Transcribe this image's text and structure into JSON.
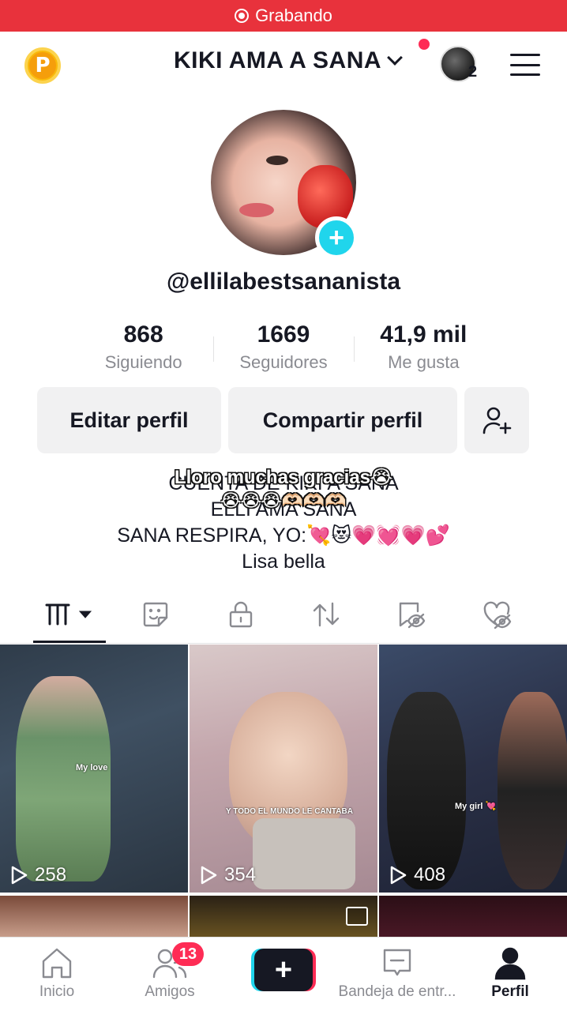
{
  "recording_bar": {
    "label": "Grabando",
    "color": "#e8323c"
  },
  "header": {
    "account_name": "KIKI AMA A SANA",
    "friends_avatar_count": "2"
  },
  "profile": {
    "username": "@ellilabestsananista",
    "stats": [
      {
        "value": "868",
        "label": "Siguiendo"
      },
      {
        "value": "1669",
        "label": "Seguidores"
      },
      {
        "value": "41,9 mil",
        "label": "Me gusta"
      }
    ],
    "buttons": {
      "edit": "Editar perfil",
      "share": "Compartir perfil"
    },
    "bio_lines": [
      "CUENTA DE KIKI A SANA",
      "ELLI AMA SANA",
      "SANA RESPIRA, YO:💘😻💗💓💗💕",
      "Lisa bella"
    ],
    "overlay_text": {
      "line1": "Lloro muchas gracias😭",
      "line2": "😭😭😭🫶🏻🫶🏻🫶🏻"
    }
  },
  "tabs": [
    {
      "name": "videos",
      "icon": "grid-icon"
    },
    {
      "name": "stickers",
      "icon": "sticker-icon"
    },
    {
      "name": "private",
      "icon": "lock-icon"
    },
    {
      "name": "reposts",
      "icon": "repost-icon"
    },
    {
      "name": "favorites",
      "icon": "hidden-bookmark-icon"
    },
    {
      "name": "liked",
      "icon": "hidden-heart-icon"
    }
  ],
  "videos": [
    {
      "views": "258",
      "caption": "My love"
    },
    {
      "views": "354",
      "caption": "Y TODO EL MUNDO LE CANTABA"
    },
    {
      "views": "408",
      "caption": "My girl 💘"
    }
  ],
  "bottom_nav": {
    "home": "Inicio",
    "friends": "Amigos",
    "friends_badge": "13",
    "create": "+",
    "inbox": "Bandeja de entr...",
    "profile": "Perfil"
  },
  "colors": {
    "accent_cyan": "#20d5ec",
    "accent_red": "#fe2c55",
    "text_dark": "#161823",
    "text_muted": "#8a8b91"
  }
}
